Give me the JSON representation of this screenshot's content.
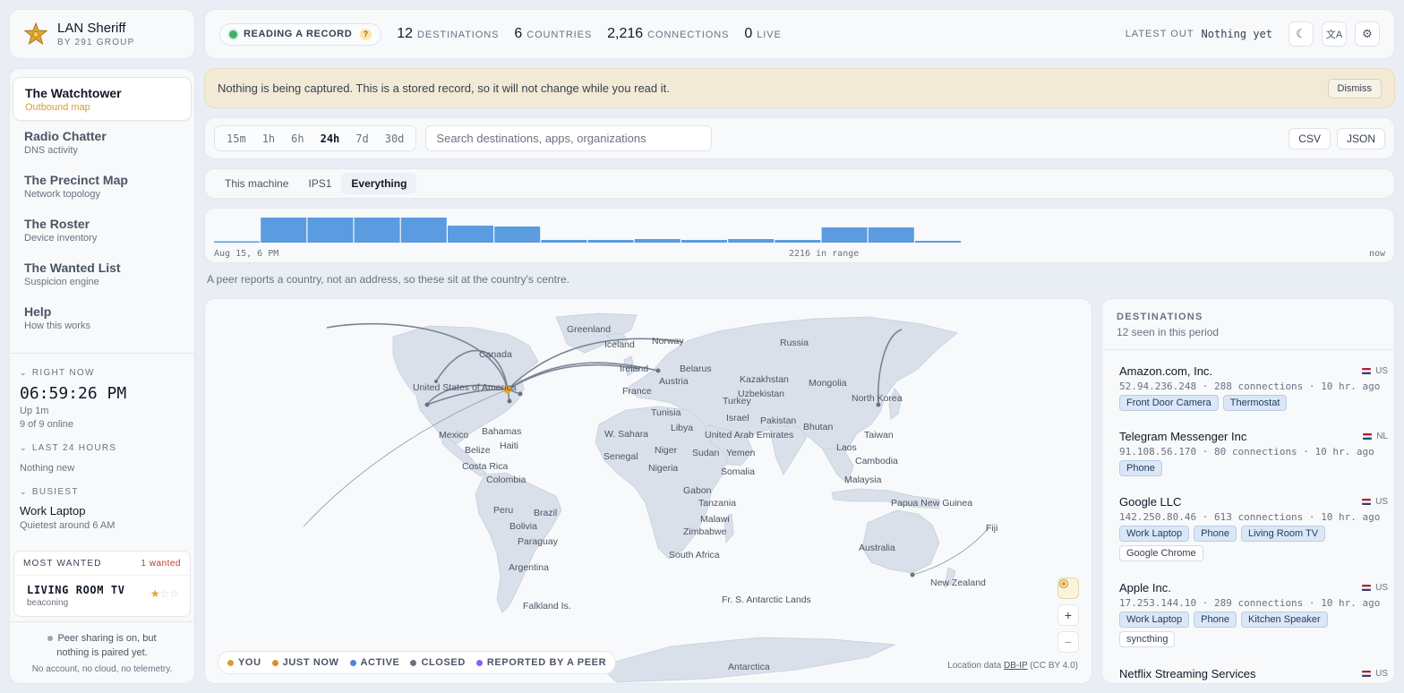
{
  "brand": {
    "name": "LAN Sheriff",
    "sub": "BY 291 GROUP"
  },
  "nav": [
    {
      "title": "The Watchtower",
      "sub": "Outbound map"
    },
    {
      "title": "Radio Chatter",
      "sub": "DNS activity"
    },
    {
      "title": "The Precinct Map",
      "sub": "Network topology"
    },
    {
      "title": "The Roster",
      "sub": "Device inventory"
    },
    {
      "title": "The Wanted List",
      "sub": "Suspicion engine"
    },
    {
      "title": "Help",
      "sub": "How this works"
    }
  ],
  "sidebar": {
    "right_now_h": "RIGHT NOW",
    "clock": "06:59:26 PM",
    "uptime": "Up 1m",
    "online": "9 of 9 online",
    "last24_h": "LAST 24 HOURS",
    "last24_v": "Nothing new",
    "busiest_h": "BUSIEST",
    "busiest_dev": "Work Laptop",
    "busiest_note": "Quietest around 6 AM",
    "wanted": {
      "h": "MOST WANTED",
      "count": "1 wanted",
      "device": "LIVING ROOM TV",
      "reason": "beaconing",
      "stars": "★",
      "stars_off": "☆☆",
      "rating": 1,
      "rating_max": 3
    },
    "peer_1": "Peer sharing is on, but",
    "peer_2": "nothing is paired yet.",
    "no_account": "No account, no cloud, no telemetry."
  },
  "topbar": {
    "mode": "READING A RECORD",
    "mode_help": "?",
    "stats": [
      {
        "n": "12",
        "l": "DESTINATIONS"
      },
      {
        "n": "6",
        "l": "COUNTRIES"
      },
      {
        "n": "2,216",
        "l": "CONNECTIONS"
      },
      {
        "n": "0",
        "l": "LIVE"
      }
    ],
    "latest_l": "LATEST OUT",
    "latest_v": "Nothing yet",
    "icons": {
      "theme": "☾",
      "lang": "文A",
      "settings": "⚙"
    }
  },
  "banner": {
    "text": "Nothing is being captured. This is a stored record, so it will not change while you read it.",
    "dismiss": "Dismiss"
  },
  "filters": {
    "ranges": [
      "15m",
      "1h",
      "6h",
      "24h",
      "7d",
      "30d"
    ],
    "selected": "24h",
    "search_placeholder": "Search destinations, apps, organizations",
    "export": [
      "CSV",
      "JSON"
    ]
  },
  "scope": {
    "options": [
      "This machine",
      "IPS1",
      "Everything"
    ],
    "selected": "Everything"
  },
  "histogram": {
    "start": "Aug 15, 6 PM",
    "middle": "2216 in range",
    "end": "now",
    "values": [
      1,
      28,
      28,
      28,
      28,
      19,
      18,
      3,
      3,
      4,
      3,
      4,
      3,
      17,
      17,
      2
    ]
  },
  "note": "A peer reports a country, not an address, so these sit at the country's centre.",
  "map": {
    "labels": [
      "Greenland",
      "Iceland",
      "Norway",
      "Russia",
      "Canada",
      "Ireland",
      "Belarus",
      "United States of America",
      "France",
      "Austria",
      "Kazakhstan",
      "Uzbekistan",
      "Mongolia",
      "Turkey",
      "North Korea",
      "Tunisia",
      "Israel",
      "Pakistan",
      "Mexico",
      "Bahamas",
      "W. Sahara",
      "Libya",
      "United Arab Emirates",
      "Bhutan",
      "Haiti",
      "Belize",
      "Taiwan",
      "Laos",
      "Senegal",
      "Niger",
      "Sudan",
      "Yemen",
      "Costa Rica",
      "Nigeria",
      "Cambodia",
      "Colombia",
      "Somalia",
      "Malaysia",
      "Gabon",
      "Tanzania",
      "Papua New Guinea",
      "Peru",
      "Brazil",
      "Bolivia",
      "Malawi",
      "Zimbabwe",
      "Fiji",
      "Paraguay",
      "Australia",
      "South Africa",
      "Argentina",
      "New Zealand",
      "Fr. S. Antarctic Lands",
      "Falkland Is.",
      "Antarctica"
    ],
    "legend": [
      {
        "label": "YOU",
        "color": "#d69e2e"
      },
      {
        "label": "JUST NOW",
        "color": "#e08a2e"
      },
      {
        "label": "ACTIVE",
        "color": "#4a86d6"
      },
      {
        "label": "CLOSED",
        "color": "#6b7280"
      },
      {
        "label": "REPORTED BY A PEER",
        "color": "#8b5cf6"
      }
    ],
    "attribution_pre": "Location data",
    "attribution_link": "DB-IP",
    "attribution_post": "(CC BY 4.0)",
    "zoom_in": "+",
    "zoom_out": "−"
  },
  "destinations": {
    "h": "DESTINATIONS",
    "sub": "12 seen in this period",
    "items": [
      {
        "org": "Amazon.com, Inc.",
        "cc": "US",
        "ip": "52.94.236.248",
        "conns": "288 connections",
        "ago": "10 hr. ago",
        "devices": [
          "Front Door Camera",
          "Thermostat"
        ],
        "apps": []
      },
      {
        "org": "Telegram Messenger Inc",
        "cc": "NL",
        "ip": "91.108.56.170",
        "conns": "80 connections",
        "ago": "10 hr. ago",
        "devices": [
          "Phone"
        ],
        "apps": []
      },
      {
        "org": "Google LLC",
        "cc": "US",
        "ip": "142.250.80.46",
        "conns": "613 connections",
        "ago": "10 hr. ago",
        "devices": [
          "Work Laptop",
          "Phone",
          "Living Room TV"
        ],
        "apps": [
          "Google Chrome"
        ]
      },
      {
        "org": "Apple Inc.",
        "cc": "US",
        "ip": "17.253.144.10",
        "conns": "289 connections",
        "ago": "10 hr. ago",
        "devices": [
          "Work Laptop",
          "Phone",
          "Kitchen Speaker"
        ],
        "apps": [
          "syncthing"
        ]
      },
      {
        "org": "Netflix Streaming Services",
        "cc": "US",
        "ip": "",
        "conns": "",
        "ago": "",
        "devices": [],
        "apps": []
      }
    ]
  }
}
